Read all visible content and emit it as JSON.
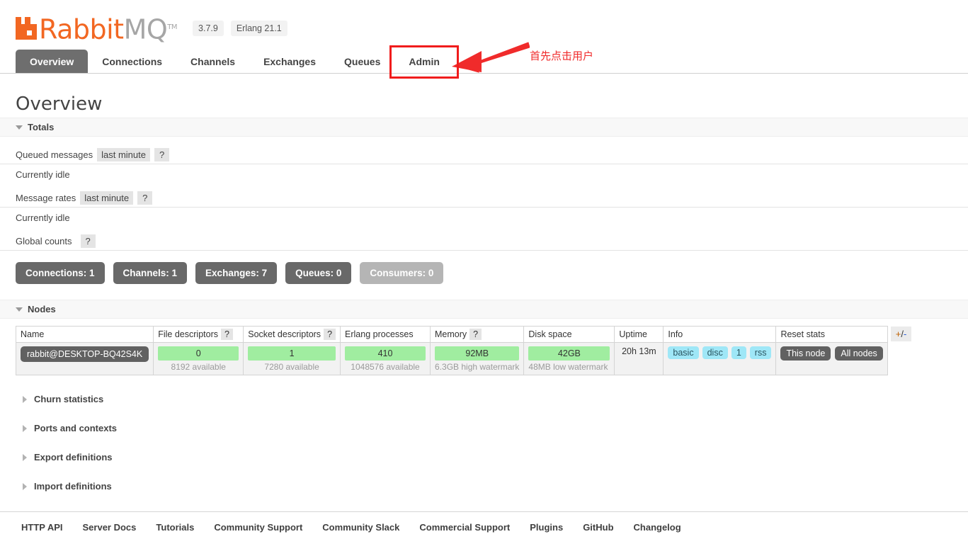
{
  "header": {
    "logo_rabbit": "Rabbit",
    "logo_mq": "MQ",
    "logo_tm": "TM",
    "version": "3.7.9",
    "erlang": "Erlang 21.1"
  },
  "tabs": [
    {
      "label": "Overview",
      "active": true
    },
    {
      "label": "Connections",
      "active": false
    },
    {
      "label": "Channels",
      "active": false
    },
    {
      "label": "Exchanges",
      "active": false
    },
    {
      "label": "Queues",
      "active": false
    },
    {
      "label": "Admin",
      "active": false
    }
  ],
  "annotation": {
    "text": "首先点击用户",
    "color": "#f02b2b",
    "highlight_color": "#f01c1c",
    "target_tab": "Admin"
  },
  "page": {
    "title": "Overview"
  },
  "totals": {
    "section_label": "Totals",
    "queued_messages_label": "Queued messages",
    "queued_messages_period": "last minute",
    "queued_messages_idle": "Currently idle",
    "message_rates_label": "Message rates",
    "message_rates_period": "last minute",
    "message_rates_idle": "Currently idle",
    "global_counts_label": "Global counts",
    "help_mark": "?"
  },
  "counts": [
    {
      "label": "Connections: 1",
      "muted": false
    },
    {
      "label": "Channels: 1",
      "muted": false
    },
    {
      "label": "Exchanges: 7",
      "muted": false
    },
    {
      "label": "Queues: 0",
      "muted": false
    },
    {
      "label": "Consumers: 0",
      "muted": true
    }
  ],
  "nodes": {
    "section_label": "Nodes",
    "columns": [
      "Name",
      "File descriptors",
      "Socket descriptors",
      "Erlang processes",
      "Memory",
      "Disk space",
      "Uptime",
      "Info",
      "Reset stats"
    ],
    "plus_minus": {
      "plus": "+",
      "slash": "/",
      "minus": "-"
    },
    "row": {
      "name": "rabbit@DESKTOP-BQ42S4K",
      "file_descriptors": {
        "value": "0",
        "sub": "8192 available"
      },
      "socket_descriptors": {
        "value": "1",
        "sub": "7280 available"
      },
      "erlang_processes": {
        "value": "410",
        "sub": "1048576 available"
      },
      "memory": {
        "value": "92MB",
        "sub": "6.3GB high watermark"
      },
      "disk_space": {
        "value": "42GB",
        "sub": "48MB low watermark"
      },
      "uptime": "20h 13m",
      "info": [
        "basic",
        "disc",
        "1",
        "rss"
      ],
      "reset_stats": [
        "This node",
        "All nodes"
      ]
    },
    "bar_color": "#a0eda0"
  },
  "collapsed_sections": [
    {
      "label": "Churn statistics"
    },
    {
      "label": "Ports and contexts"
    },
    {
      "label": "Export definitions"
    },
    {
      "label": "Import definitions"
    }
  ],
  "footer_links": [
    "HTTP API",
    "Server Docs",
    "Tutorials",
    "Community Support",
    "Community Slack",
    "Commercial Support",
    "Plugins",
    "GitHub",
    "Changelog"
  ]
}
